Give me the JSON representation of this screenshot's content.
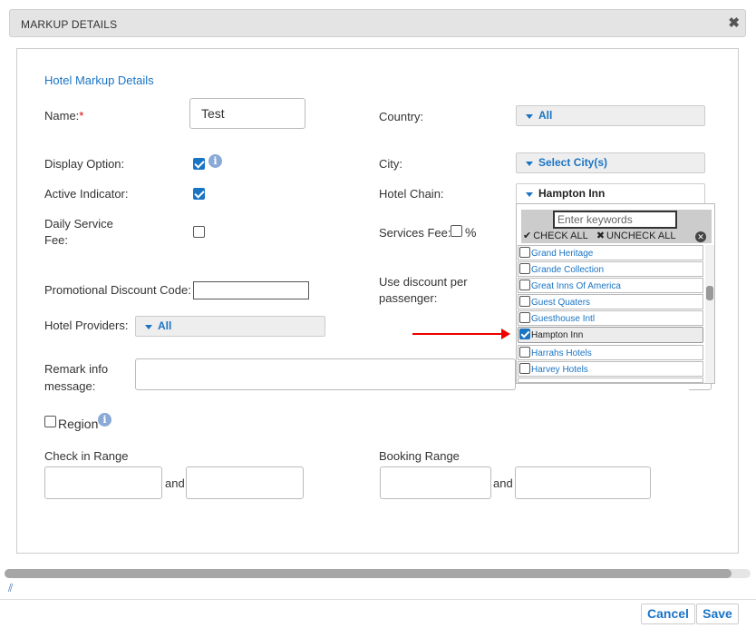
{
  "dialog": {
    "title": "MARKUP DETAILS",
    "close_glyph": "✖"
  },
  "section_title": "Hotel Markup Details",
  "form": {
    "name_label": "Name:",
    "name_required": "*",
    "name_value": "Test",
    "display_option_label": "Display Option:",
    "display_option_checked": true,
    "active_indicator_label": "Active Indicator:",
    "active_indicator_checked": true,
    "daily_service_fee_label_1": "Daily Service",
    "daily_service_fee_label_2": "Fee:",
    "daily_service_fee_checked": false,
    "promo_code_label": "Promotional Discount Code:",
    "promo_code_value": "",
    "hotel_providers_label": "Hotel Providers:",
    "hotel_providers_value": "All",
    "remark_label_1": "Remark info",
    "remark_label_2": "message:",
    "region_label": "Region",
    "region_checked": false,
    "checkin_range_label": "Check in Range",
    "checkin_and": "and",
    "country_label": "Country:",
    "country_value": "All",
    "city_label": "City:",
    "city_value": "Select City(s)",
    "hotel_chain_label": "Hotel Chain:",
    "hotel_chain_value": "Hampton Inn",
    "services_fee_label": "Services Fee:",
    "services_fee_unit": "%",
    "use_discount_label_1": "Use discount per",
    "use_discount_label_2": "passenger:",
    "booking_range_label": "Booking Range",
    "booking_and": "and"
  },
  "hotel_chain_dropdown": {
    "search_placeholder": "Enter keywords",
    "check_all": "CHECK ALL",
    "uncheck_all": "UNCHECK ALL",
    "items": [
      {
        "name": "Grand Heritage",
        "checked": false
      },
      {
        "name": "Grande Collection",
        "checked": false
      },
      {
        "name": "Great Inns Of America",
        "checked": false
      },
      {
        "name": "Guest Quaters",
        "checked": false
      },
      {
        "name": "Guesthouse Intl",
        "checked": false
      },
      {
        "name": "Hampton Inn",
        "checked": true
      },
      {
        "name": "Harrahs Hotels",
        "checked": false
      },
      {
        "name": "Harvey Hotels",
        "checked": false
      }
    ]
  },
  "footer": {
    "cancel_label": "Cancel",
    "save_label": "Save"
  },
  "colors": {
    "accent": "#1a74c4",
    "arrow": "#e00000",
    "required": "#dd0000"
  }
}
